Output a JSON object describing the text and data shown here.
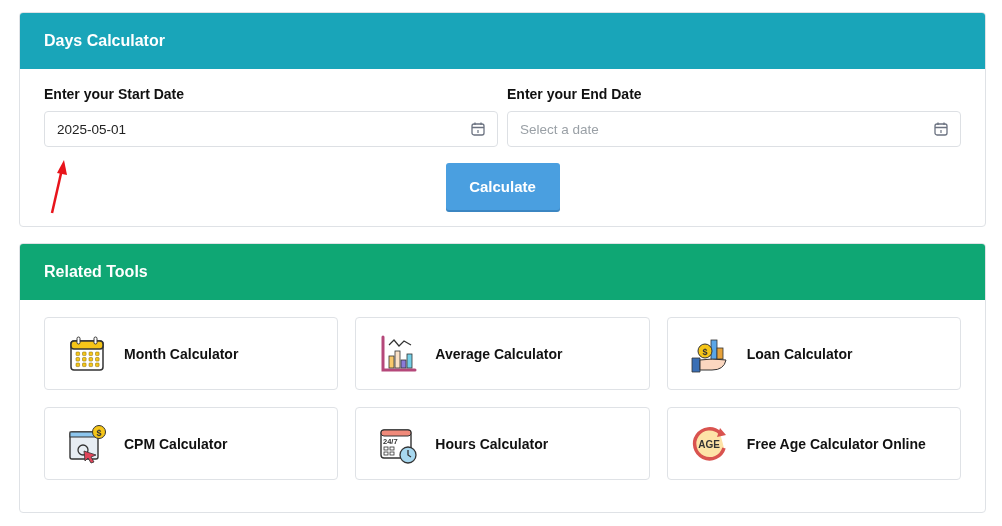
{
  "calculator": {
    "title": "Days Calculator",
    "fields": [
      {
        "label": "Enter your Start Date",
        "value": "2025-05-01"
      },
      {
        "label": "Enter your End Date",
        "placeholder": "Select a date"
      }
    ],
    "button": "Calculate"
  },
  "related": {
    "title": "Related Tools",
    "tools": [
      {
        "name": "Month Calculator",
        "kind": "calendar"
      },
      {
        "name": "Average Calculator",
        "kind": "chart"
      },
      {
        "name": "Loan Calculator",
        "kind": "loan",
        "icon_text": "$"
      },
      {
        "name": "CPM Calculator",
        "kind": "cpm",
        "icon_text": "$"
      },
      {
        "name": "Hours Calculator",
        "kind": "hours",
        "icon_text": "24/7"
      },
      {
        "name": "Free Age Calculator Online",
        "kind": "age",
        "icon_text": "AGE"
      }
    ]
  }
}
